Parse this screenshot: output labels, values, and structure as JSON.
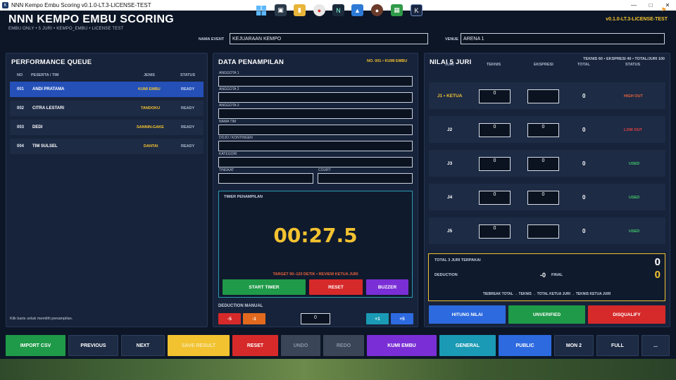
{
  "window": {
    "title": "NNN Kempo Embu Scoring v0.1.0-LT.3-LICENSE-TEST"
  },
  "header": {
    "title": "NNN KEMPO EMBU SCORING",
    "subtitle": "EMBU ONLY • 5 JURI • KEMPO_EMBU • LICENSE TEST",
    "version": "v0.1.0-LT.3-LICENSE-TEST",
    "event_label": "NAMA EVENT",
    "event_value": "KEJUARAAN KEMPO",
    "venue_label": "VENUE",
    "venue_value": "ARENA 1"
  },
  "queue": {
    "title": "PERFORMANCE QUEUE",
    "headers": {
      "no": "NO",
      "peserta": "PESERTA / TIM",
      "jenis": "JENIS",
      "status": "STATUS"
    },
    "rows": [
      {
        "no": "001",
        "name": "ANDI PRATAMA",
        "jenis": "KUMI EMBU",
        "status": "READY"
      },
      {
        "no": "002",
        "name": "CITRA LESTARI",
        "jenis": "TANDOKU",
        "status": "READY"
      },
      {
        "no": "003",
        "name": "DEDI",
        "jenis": "SANNIN-GAKE",
        "status": "READY"
      },
      {
        "no": "004",
        "name": "TIM SULSEL",
        "jenis": "DANTAI",
        "status": "READY"
      }
    ],
    "hint": "Klik baris untuk memilih penampilan."
  },
  "data": {
    "title": "DATA PENAMPILAN",
    "tag": "NO. 001 • KUMI EMBU",
    "fields": {
      "anggota1": "ANGGOTA 1",
      "anggota2": "ANGGOTA 2",
      "anggota3": "ANGGOTA 3",
      "nama_tim": "NAMA TIM",
      "dojo": "DOJO / KONTINGEN",
      "kategori": "KATEGORI",
      "tingkat": "TINGKAT",
      "court": "COURT"
    },
    "timer": {
      "label": "TIMER PENAMPILAN",
      "value": "00:27.5",
      "target": "TARGET 90–120 DETIK • REVIEW KETUA JURI",
      "start": "START TIMER",
      "reset": "RESET",
      "buzzer": "BUZZER"
    },
    "deduction": {
      "label": "DEDUCTION MANUAL",
      "m5": "-5",
      "m1": "-1",
      "value": "0",
      "p1": "+1",
      "p5": "+5"
    }
  },
  "nilai": {
    "title": "NILAI 5 JURI",
    "subtitle": "TEKNIS 60 • EKSPRESI 40 • TOTAL/JURI 100",
    "headers": {
      "juri": "JURI",
      "teknis": "TEKNIS",
      "ekspresi": "EKSPRESI",
      "total": "TOTAL",
      "status": "STATUS"
    },
    "rows": [
      {
        "juri": "J1 • KETUA",
        "teknis": "0",
        "ekspresi": "",
        "total": "0",
        "status": "HIGH OUT",
        "status_color": "#e8623a",
        "juri_color": "#f2c230"
      },
      {
        "juri": "J2",
        "teknis": "0",
        "ekspresi": "0",
        "total": "0",
        "status": "LOW OUT",
        "status_color": "#e84040",
        "juri_color": "#ffffff"
      },
      {
        "juri": "J3",
        "teknis": "0",
        "ekspresi": "0",
        "total": "0",
        "status": "USED",
        "status_color": "#3fc56a",
        "juri_color": "#ffffff"
      },
      {
        "juri": "J4",
        "teknis": "0",
        "ekspresi": "0",
        "total": "0",
        "status": "USED",
        "status_color": "#3fc56a",
        "juri_color": "#ffffff"
      },
      {
        "juri": "J5",
        "teknis": "0",
        "ekspresi": "",
        "total": "0",
        "status": "USED",
        "status_color": "#3fc56a",
        "juri_color": "#ffffff"
      }
    ],
    "summary": {
      "total_label": "TOTAL 3 JURI TERPAKAI",
      "total_value": "0",
      "deduction_label": "DEDUCTION",
      "deduction_value": "-0",
      "final_label": "FINAL",
      "final_value": "0",
      "tiebreak": "TIEBREAK TOTAL → TEKNIS → TOTAL KETUA JURI → TEKNIS KETUA JURI"
    },
    "hitung": "HITUNG NILAI",
    "unverified": "UNVERIFIED",
    "disqualify": "DISQUALIFY"
  },
  "bottom": {
    "import_csv": "IMPORT CSV",
    "previous": "PREVIOUS",
    "next": "NEXT",
    "save_result": "SAVE RESULT",
    "reset": "RESET",
    "undo": "UNDO",
    "redo": "REDO",
    "kumi_embu": "KUMI EMBU",
    "general": "GENERAL",
    "public": "PUBLIC",
    "mon2": "MON 2",
    "full": "FULL",
    "more": "..."
  },
  "colors": {
    "accent_yellow": "#f2c230",
    "accent_blue": "#2450b8",
    "green": "#1f9a48",
    "red": "#d62a2a",
    "purple": "#7a2fd6",
    "teal": "#1a9ab4"
  }
}
